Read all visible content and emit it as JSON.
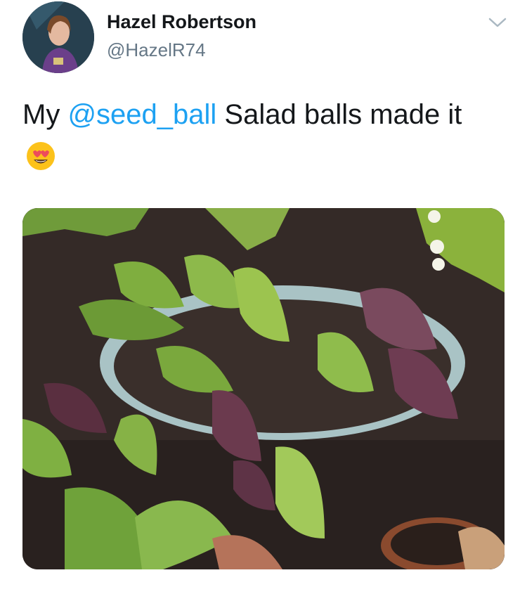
{
  "user": {
    "display_name": "Hazel Robertson",
    "handle": "@HazelR74",
    "avatar_icon": "avatar-photo"
  },
  "tweet": {
    "text_prefix": "My ",
    "mention": "@seed_ball",
    "text_suffix": " Salad balls made it",
    "emoji": "heart-eyes-emoji",
    "menu_icon": "chevron-down-icon"
  },
  "media": {
    "description_icon": "salad-plant-photo"
  },
  "colors": {
    "link": "#1da1f2",
    "secondary_text": "#657786",
    "primary_text": "#14171a"
  }
}
